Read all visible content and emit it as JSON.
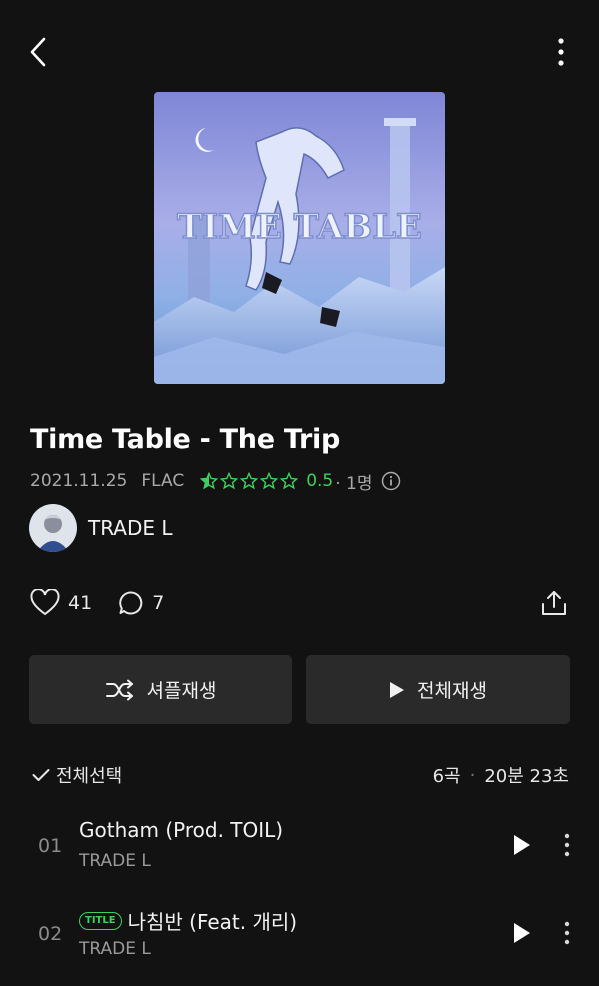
{
  "header": {
    "back_icon": "back-chevron-icon",
    "more_icon": "more-vertical-icon"
  },
  "album": {
    "cover_text": "TIME TABLE",
    "title": "Time Table - The Trip",
    "release_date": "2021.11.25",
    "format": "FLAC",
    "rating": "0.5",
    "rating_count": "· 1명",
    "rating_fraction": 0.1
  },
  "artist": {
    "name": "TRADE L"
  },
  "social": {
    "likes": "41",
    "comments": "7"
  },
  "actions": {
    "shuffle_label": "셔플재생",
    "play_all_label": "전체재생"
  },
  "tracklist": {
    "select_all_label": "전체선택",
    "count": "6곡",
    "duration": "20분 23초",
    "tracks": [
      {
        "number": "01",
        "title": "Gotham (Prod. TOIL)",
        "artist": "TRADE L",
        "badge": ""
      },
      {
        "number": "02",
        "title": "나침반 (Feat. 개리)",
        "artist": "TRADE L",
        "badge": "TITLE"
      }
    ]
  },
  "colors": {
    "background": "#121212",
    "accent": "#3ecf5a",
    "button_bg": "#2a2a2a"
  }
}
